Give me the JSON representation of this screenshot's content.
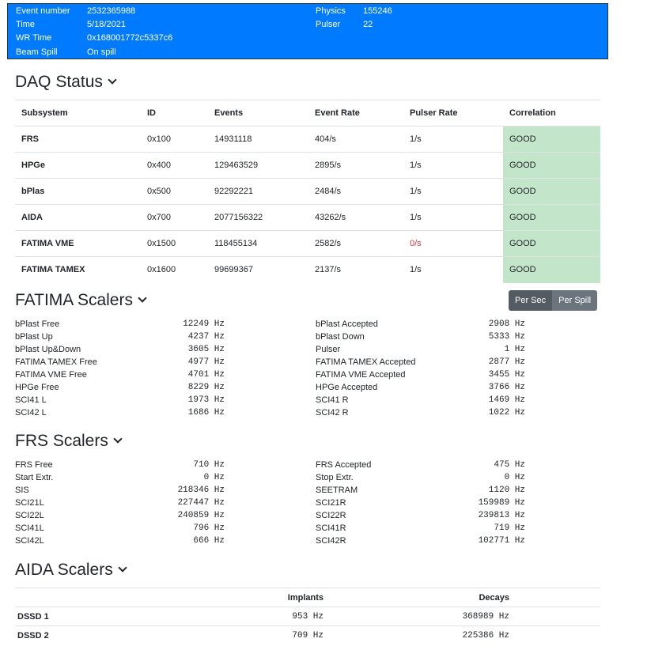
{
  "header": {
    "left": [
      {
        "label": "Event number",
        "value": "2532365988"
      },
      {
        "label": "Time",
        "value": "5/18/2021"
      },
      {
        "label": "WR Time",
        "value": "0x168001772c5337c6"
      },
      {
        "label": "Beam Spill",
        "value": "On spill"
      }
    ],
    "right": [
      {
        "label": "Physics",
        "value": "155246"
      },
      {
        "label": "Pulser",
        "value": "22"
      }
    ]
  },
  "daq": {
    "title": "DAQ Status",
    "columns": [
      "Subsystem",
      "ID",
      "Events",
      "Event Rate",
      "Pulser Rate",
      "Correlation"
    ],
    "rows": [
      [
        "FRS",
        "0x100",
        "14931118",
        "404/s",
        "1/s",
        "GOOD"
      ],
      [
        "HPGe",
        "0x400",
        "129463529",
        "2895/s",
        "1/s",
        "GOOD"
      ],
      [
        "bPlas",
        "0x500",
        "92292221",
        "2484/s",
        "1/s",
        "GOOD"
      ],
      [
        "AIDA",
        "0x700",
        "2077156322",
        "43262/s",
        "1/s",
        "GOOD"
      ],
      [
        "FATIMA VME",
        "0x1500",
        "118455134",
        "2582/s",
        "0/s",
        "GOOD"
      ],
      [
        "FATIMA TAMEX",
        "0x1600",
        "99699367",
        "2137/s",
        "1/s",
        "GOOD"
      ]
    ]
  },
  "fatima": {
    "title": "FATIMA Scalers",
    "per_sec": "Per Sec",
    "per_spill": "Per Spill",
    "left": [
      [
        "bPlast Free",
        "12249 Hz"
      ],
      [
        "bPlast Up",
        "4237 Hz"
      ],
      [
        "bPlast Up&Down",
        "3605 Hz"
      ],
      [
        "FATIMA TAMEX Free",
        "4977 Hz"
      ],
      [
        "FATIMA VME Free",
        "4701 Hz"
      ],
      [
        "HPGe Free",
        "8229 Hz"
      ],
      [
        "SCI41 L",
        "1973 Hz"
      ],
      [
        "SCI42 L",
        "1686 Hz"
      ]
    ],
    "right": [
      [
        "bPlast Accepted",
        "2908 Hz"
      ],
      [
        "bPlast Down",
        "5333 Hz"
      ],
      [
        "Pulser",
        "1 Hz"
      ],
      [
        "FATIMA TAMEX Accepted",
        "2877 Hz"
      ],
      [
        "FATIMA VME Accepted",
        "3455 Hz"
      ],
      [
        "HPGe Accepted",
        "3766 Hz"
      ],
      [
        "SCI41 R",
        "1469 Hz"
      ],
      [
        "SCI42 R",
        "1022 Hz"
      ]
    ]
  },
  "frs": {
    "title": "FRS Scalers",
    "left": [
      [
        "FRS Free",
        "710 Hz"
      ],
      [
        "Start Extr.",
        "0 Hz"
      ],
      [
        "SIS",
        "218346 Hz"
      ],
      [
        "SCI21L",
        "227447 Hz"
      ],
      [
        "SCI22L",
        "240859 Hz"
      ],
      [
        "SCI41L",
        "796 Hz"
      ],
      [
        "SCI42L",
        "666 Hz"
      ]
    ],
    "right": [
      [
        "FRS Accepted",
        "475 Hz"
      ],
      [
        "Stop Extr.",
        "0 Hz"
      ],
      [
        "SEETRAM",
        "1120 Hz"
      ],
      [
        "SCI21R",
        "159989 Hz"
      ],
      [
        "SCI22R",
        "239813 Hz"
      ],
      [
        "SCI41R",
        "719 Hz"
      ],
      [
        "SCI42R",
        "102771 Hz"
      ]
    ]
  },
  "aida": {
    "title": "AIDA Scalers",
    "columns": [
      "",
      "Implants",
      "Decays"
    ],
    "rows": [
      [
        "DSSD 1",
        "953 Hz",
        "368989 Hz"
      ],
      [
        "DSSD 2",
        "709 Hz",
        "225386 Hz"
      ]
    ]
  },
  "colors": {
    "accent": "#007bff",
    "good": "#c3e6cb",
    "bad": "#dc3545"
  }
}
